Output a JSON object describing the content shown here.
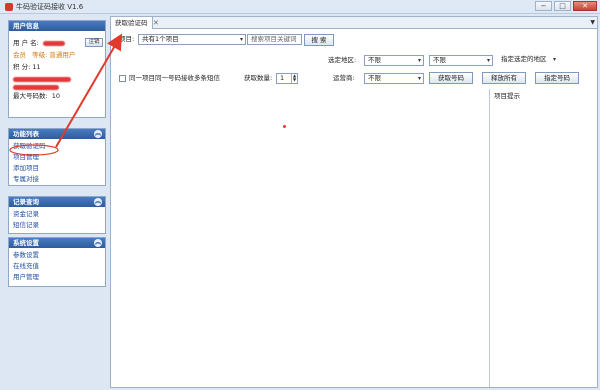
{
  "window": {
    "title": "牛码验证码接收 V1.6",
    "buttons": [
      "−",
      "□",
      "✕"
    ]
  },
  "sidebar": {
    "user_panel": {
      "title": "用户信息",
      "username_label": "用 户 名:",
      "login_button": "注销",
      "member_label": "会员",
      "level_label": "等级:",
      "level_value": "普通用户",
      "points_label": "积     分:",
      "points_value": "11",
      "max_codes_label": "最大号码数:",
      "max_codes_value": "10"
    },
    "function_panel": {
      "title": "功能列表",
      "items": [
        "获取验证码",
        "项目管理",
        "添加项目",
        "专属对接"
      ]
    },
    "records_panel": {
      "title": "记录查询",
      "items": [
        "资金记录",
        "短信记录"
      ]
    },
    "settings_panel": {
      "title": "系统设置",
      "items": [
        "参数设置",
        "在线充值",
        "用户管理"
      ]
    }
  },
  "main": {
    "tab": {
      "label": "获取验证码",
      "close": "✕"
    },
    "toolbar": {
      "project_label": "项目:",
      "project_value": "共有1个项目",
      "search_placeholder": "搜索项目关键词",
      "search_button": "搜 索",
      "region_label": "选定地区:",
      "region_value_1": "不限",
      "region_value_2": "不限",
      "region_assign": "指定选定的地区",
      "checkbox_label": "同一项目同一号码接收多条短信",
      "quantity_label": "获取数量:",
      "quantity_value": "1",
      "carrier_label": "运营商:",
      "carrier_value": "不限",
      "get_number_button": "获取号码",
      "release_all_button": "释放所有",
      "assign_number_button": "指定号码"
    },
    "hint_title": "项目提示"
  },
  "colors": {
    "accent": "#2d5b9e",
    "annotation": "#e23a2a"
  }
}
